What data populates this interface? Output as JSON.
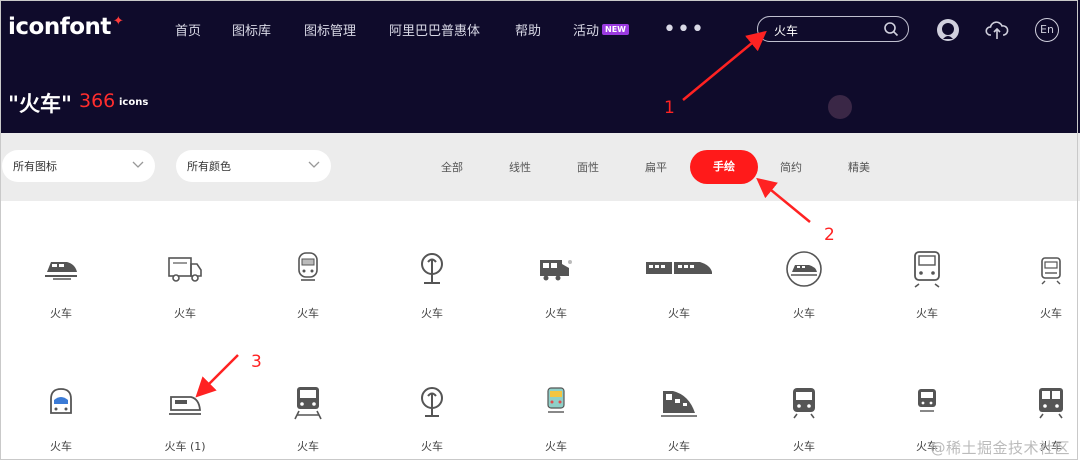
{
  "header": {
    "logo": "iconfont",
    "nav": [
      {
        "label": "首页"
      },
      {
        "label": "图标库"
      },
      {
        "label": "图标管理"
      },
      {
        "label": "阿里巴巴普惠体"
      },
      {
        "label": "帮助"
      },
      {
        "label": "活动",
        "badge": "NEW"
      }
    ],
    "more_label": "•••",
    "search": {
      "value": "火车"
    },
    "icons": [
      "github-icon",
      "upload-icon",
      "language-en-icon"
    ],
    "language_label": "En"
  },
  "result": {
    "query_title": "\"火车\"",
    "count": "366",
    "unit": "icons"
  },
  "filters": {
    "icon_type_select": "所有图标",
    "color_select": "所有颜色",
    "styles": [
      "全部",
      "线性",
      "面性",
      "扁平",
      "手绘",
      "简约",
      "精美"
    ],
    "active_style": "手绘"
  },
  "grid": {
    "row1": [
      "火车",
      "火车",
      "火车",
      "火车",
      "火车",
      "火车",
      "火车",
      "火车",
      "火车"
    ],
    "row2": [
      "火车",
      "火车 (1)",
      "火车",
      "火车",
      "火车",
      "火车",
      "火车",
      "火车",
      "火车"
    ]
  },
  "annotations": [
    "1",
    "2",
    "3"
  ],
  "watermark": "@稀土掘金技术社区",
  "colors": {
    "header_bg": "#0f0b2b",
    "accent": "#ff1a1a",
    "filter_bg": "#ececec"
  }
}
